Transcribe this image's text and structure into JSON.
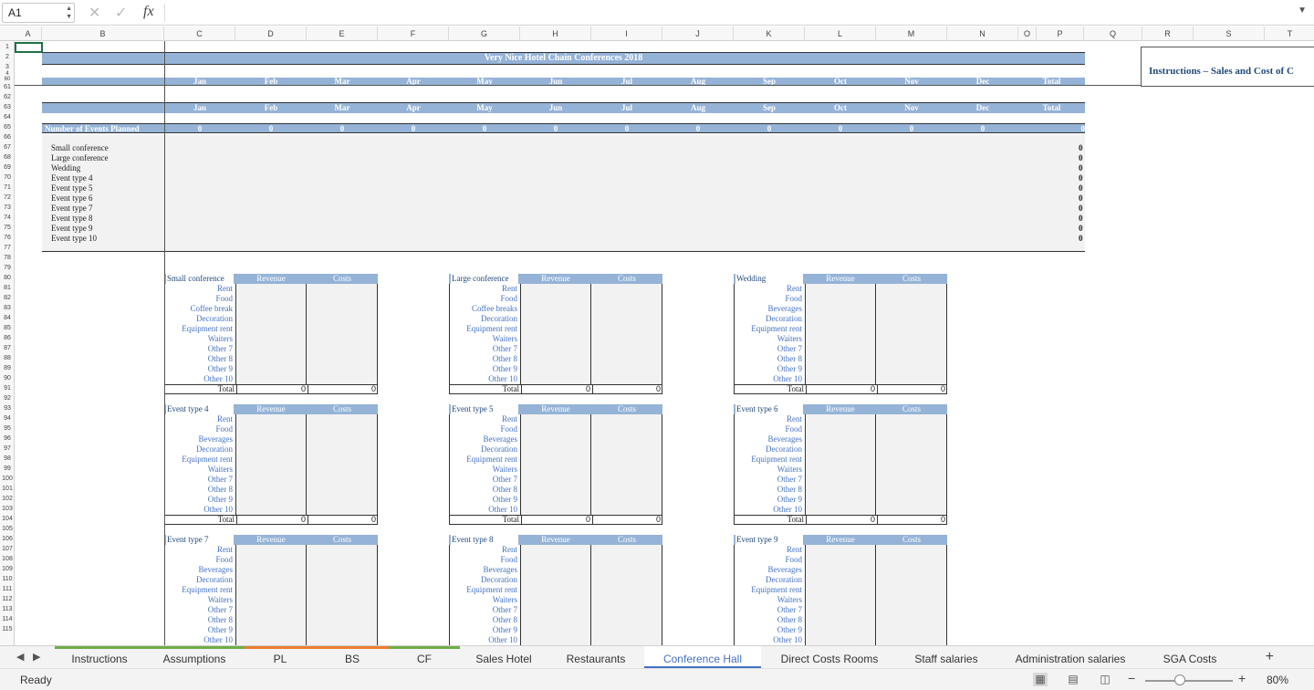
{
  "formula_bar": {
    "name_box": "A1",
    "formula": ""
  },
  "columns": [
    "A",
    "B",
    "C",
    "D",
    "E",
    "F",
    "G",
    "H",
    "I",
    "J",
    "K",
    "L",
    "M",
    "N",
    "O",
    "P",
    "Q",
    "R",
    "S",
    "T"
  ],
  "rows": [
    "1",
    "2",
    "3",
    "4",
    "60",
    "61",
    "62",
    "63",
    "64",
    "65",
    "66",
    "67",
    "68",
    "69",
    "70",
    "71",
    "72",
    "73",
    "74",
    "75",
    "76",
    "77",
    "78",
    "79",
    "80",
    "81",
    "82",
    "83",
    "84",
    "85",
    "86",
    "87",
    "88",
    "89",
    "90",
    "91",
    "92",
    "93",
    "94",
    "95",
    "96",
    "97",
    "98",
    "99",
    "100",
    "101",
    "102",
    "103",
    "104",
    "105",
    "106",
    "107",
    "108",
    "109",
    "110",
    "111",
    "112",
    "113",
    "114",
    "115"
  ],
  "sheet": {
    "title": "Very Nice Hotel Chain Conferences 2018",
    "months": [
      "Jan",
      "Feb",
      "Mar",
      "Apr",
      "May",
      "Jun",
      "Jul",
      "Aug",
      "Sep",
      "Oct",
      "Nov",
      "Dec",
      "Total"
    ],
    "instructions_title": "Instructions – Sales and Cost of C",
    "events_planned_label": "Number of Events Planned",
    "events_planned_values": [
      "0",
      "0",
      "0",
      "0",
      "0",
      "0",
      "0",
      "0",
      "0",
      "0",
      "0",
      "0",
      "0"
    ],
    "event_types": [
      "Small conference",
      "Large conference",
      "Wedding",
      "Event type 4",
      "Event type 5",
      "Event type 6",
      "Event type 7",
      "Event type 8",
      "Event type 9",
      "Event type 10"
    ],
    "event_totals": [
      "0",
      "0",
      "0",
      "0",
      "0",
      "0",
      "0",
      "0",
      "0",
      "0"
    ]
  },
  "tables": [
    {
      "name": "Small conference",
      "revenue": "Revenue",
      "costs": "Costs",
      "rows": [
        "Rent",
        "Food",
        "Coffee break",
        "Decoration",
        "Equipment rent",
        "Waiters",
        "Other 7",
        "Other 8",
        "Other 9",
        "Other 10"
      ],
      "total_label": "Total",
      "total_rev": "0",
      "total_cost": "0"
    },
    {
      "name": "Large conference",
      "revenue": "Revenue",
      "costs": "Costs",
      "rows": [
        "Rent",
        "Food",
        "Coffee breaks",
        "Decoration",
        "Equipment rent",
        "Waiters",
        "Other 7",
        "Other 8",
        "Other 9",
        "Other 10"
      ],
      "total_label": "Total",
      "total_rev": "0",
      "total_cost": "0"
    },
    {
      "name": "Wedding",
      "revenue": "Revenue",
      "costs": "Costs",
      "rows": [
        "Rent",
        "Food",
        "Beverages",
        "Decoration",
        "Equipment rent",
        "Waiters",
        "Other 7",
        "Other 8",
        "Other 9",
        "Other 10"
      ],
      "total_label": "Total",
      "total_rev": "0",
      "total_cost": "0"
    },
    {
      "name": "Event type 4",
      "revenue": "Revenue",
      "costs": "Costs",
      "rows": [
        "Rent",
        "Food",
        "Beverages",
        "Decoration",
        "Equipment rent",
        "Waiters",
        "Other 7",
        "Other 8",
        "Other 9",
        "Other 10"
      ],
      "total_label": "Total",
      "total_rev": "0",
      "total_cost": "0"
    },
    {
      "name": "Event type 5",
      "revenue": "Revenue",
      "costs": "Costs",
      "rows": [
        "Rent",
        "Food",
        "Beverages",
        "Decoration",
        "Equipment rent",
        "Waiters",
        "Other 7",
        "Other 8",
        "Other 9",
        "Other 10"
      ],
      "total_label": "Total",
      "total_rev": "0",
      "total_cost": "0"
    },
    {
      "name": "Event type 6",
      "revenue": "Revenue",
      "costs": "Costs",
      "rows": [
        "Rent",
        "Food",
        "Beverages",
        "Decoration",
        "Equipment rent",
        "Waiters",
        "Other 7",
        "Other 8",
        "Other 9",
        "Other 10"
      ],
      "total_label": "Total",
      "total_rev": "0",
      "total_cost": "0"
    },
    {
      "name": "Event type 7",
      "revenue": "Revenue",
      "costs": "Costs",
      "rows": [
        "Rent",
        "Food",
        "Beverages",
        "Decoration",
        "Equipment rent",
        "Waiters",
        "Other 7",
        "Other 8",
        "Other 9",
        "Other 10"
      ],
      "total_label": "",
      "total_rev": "",
      "total_cost": ""
    },
    {
      "name": "Event type 8",
      "revenue": "Revenue",
      "costs": "Costs",
      "rows": [
        "Rent",
        "Food",
        "Beverages",
        "Decoration",
        "Equipment rent",
        "Waiters",
        "Other 7",
        "Other 8",
        "Other 9",
        "Other 10"
      ],
      "total_label": "",
      "total_rev": "",
      "total_cost": ""
    },
    {
      "name": "Event type 9",
      "revenue": "Revenue",
      "costs": "Costs",
      "rows": [
        "Rent",
        "Food",
        "Beverages",
        "Decoration",
        "Equipment rent",
        "Waiters",
        "Other 7",
        "Other 8",
        "Other 9",
        "Other 10"
      ],
      "total_label": "",
      "total_rev": "",
      "total_cost": ""
    }
  ],
  "tabs": [
    "Instructions",
    "Assumptions",
    "PL",
    "BS",
    "CF",
    "Sales Hotel",
    "Restaurants",
    "Conference Hall",
    "Direct Costs Rooms",
    "Staff salaries",
    "Administration salaries",
    "SGA Costs"
  ],
  "active_tab": "Conference Hall",
  "status": {
    "text": "Ready",
    "zoom": "80%"
  },
  "icons": {
    "cancel": "✕",
    "confirm": "✓",
    "function": "fx",
    "add_sheet": "+"
  },
  "colors": {
    "header_blue": "#95b3d7",
    "accent_blue": "#4472c4",
    "selection_green": "#1e7145",
    "input_grey": "#f2f2f2"
  }
}
